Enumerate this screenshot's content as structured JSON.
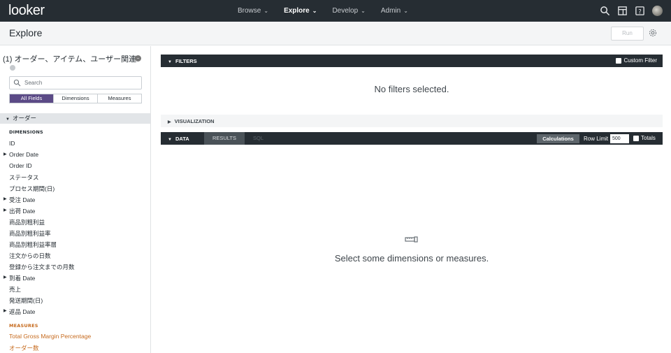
{
  "topnav": {
    "logo": "looker",
    "items": [
      {
        "label": "Browse"
      },
      {
        "label": "Explore"
      },
      {
        "label": "Develop"
      },
      {
        "label": "Admin"
      }
    ],
    "icons": [
      "search-icon",
      "browse-window-icon",
      "help-icon",
      "avatar"
    ]
  },
  "subheader": {
    "title": "Explore",
    "run_label": "Run"
  },
  "sidebar": {
    "explore_name": "(1) オーダー、アイテム、ユーザー関連",
    "search_placeholder": "Search",
    "tabs": [
      "All Fields",
      "Dimensions",
      "Measures"
    ],
    "view_name": "オーダー",
    "dimensions_header": "DIMENSIONS",
    "dimensions": [
      {
        "label": "ID",
        "group": false
      },
      {
        "label": "Order Date",
        "group": true
      },
      {
        "label": "Order ID",
        "group": false
      },
      {
        "label": "ステータス",
        "group": false
      },
      {
        "label": "プロセス期間(日)",
        "group": false
      },
      {
        "label": "受注 Date",
        "group": true
      },
      {
        "label": "出荷 Date",
        "group": true
      },
      {
        "label": "商品別粗利益",
        "group": false
      },
      {
        "label": "商品別粗利益率",
        "group": false
      },
      {
        "label": "商品別粗利益率層",
        "group": false
      },
      {
        "label": "注文からの日数",
        "group": false
      },
      {
        "label": "登録から注文までの月数",
        "group": false
      },
      {
        "label": "到着 Date",
        "group": true
      },
      {
        "label": "売上",
        "group": false
      },
      {
        "label": "発送期間(日)",
        "group": false
      },
      {
        "label": "返品 Date",
        "group": true
      }
    ],
    "measures_header": "MEASURES",
    "measures": [
      {
        "label": "Total Gross Margin Percentage"
      },
      {
        "label": "オーダー数"
      }
    ]
  },
  "filters": {
    "title": "FILTERS",
    "custom_filter_label": "Custom Filter",
    "empty_text": "No filters selected."
  },
  "visualization": {
    "title": "VISUALIZATION"
  },
  "data": {
    "title": "DATA",
    "tab_results": "RESULTS",
    "tab_sql": "SQL",
    "calculations_label": "Calculations",
    "row_limit_label": "Row Limit",
    "row_limit_value": "500",
    "totals_label": "Totals",
    "empty_text": "Select some dimensions or measures."
  },
  "colors": {
    "nav_bg": "#262d33",
    "accent_purple": "#5b4a86",
    "measure_orange": "#c66a1d"
  }
}
